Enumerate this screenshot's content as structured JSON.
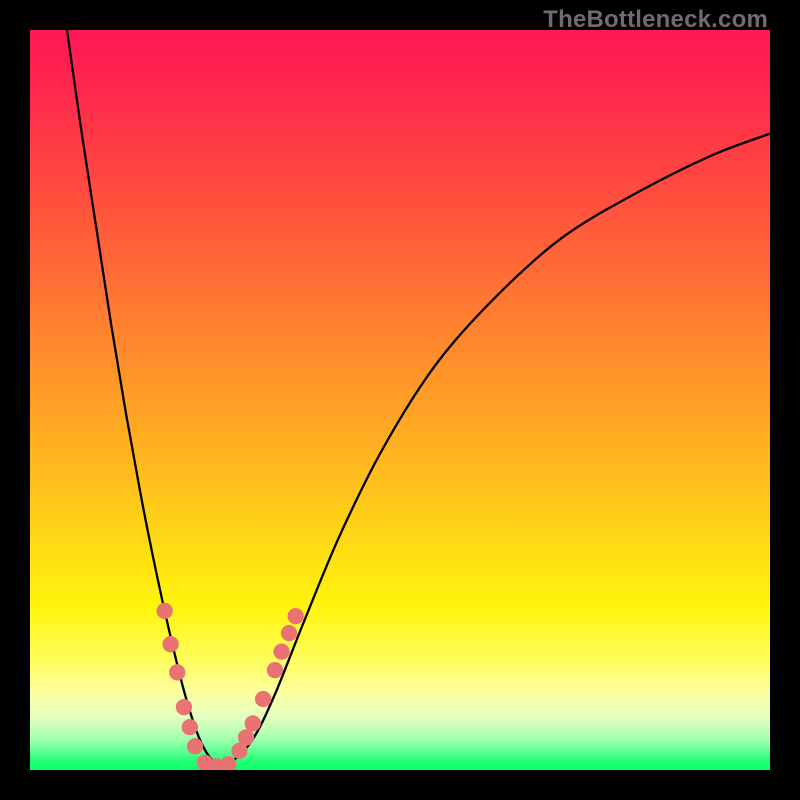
{
  "watermark": "TheBottleneck.com",
  "palette": {
    "frame": "#000000",
    "watermark": "#6d6d6d",
    "curve": "#000000",
    "marker": "#e97373",
    "gradient_top": "#ff1854",
    "gradient_bottom": "#0dff68"
  },
  "chart_data": {
    "type": "line",
    "title": "",
    "xlabel": "",
    "ylabel": "",
    "xlim": [
      0,
      100
    ],
    "ylim": [
      0,
      100
    ],
    "grid": false,
    "legend": false,
    "series": [
      {
        "name": "bottleneck-curve",
        "x": [
          5,
          7,
          9,
          11,
          13,
          15,
          17,
          19,
          21,
          23,
          25,
          27,
          30,
          33,
          37,
          42,
          48,
          55,
          63,
          72,
          82,
          92,
          100
        ],
        "y": [
          100,
          86,
          73,
          60,
          48,
          37,
          27,
          18,
          10,
          4,
          1,
          1,
          4,
          10,
          20,
          32,
          44,
          55,
          64,
          72,
          78,
          83,
          86
        ]
      }
    ],
    "markers": {
      "name": "highlighted-points",
      "points": [
        {
          "x": 18.2,
          "y": 21.5
        },
        {
          "x": 19.0,
          "y": 17.0
        },
        {
          "x": 19.9,
          "y": 13.2
        },
        {
          "x": 20.8,
          "y": 8.5
        },
        {
          "x": 21.6,
          "y": 5.8
        },
        {
          "x": 22.3,
          "y": 3.2
        },
        {
          "x": 23.6,
          "y": 1.0
        },
        {
          "x": 25.2,
          "y": 0.5
        },
        {
          "x": 26.8,
          "y": 0.8
        },
        {
          "x": 28.3,
          "y": 2.6
        },
        {
          "x": 29.2,
          "y": 4.4
        },
        {
          "x": 30.1,
          "y": 6.3
        },
        {
          "x": 31.5,
          "y": 9.6
        },
        {
          "x": 33.1,
          "y": 13.5
        },
        {
          "x": 34.0,
          "y": 16.0
        },
        {
          "x": 35.0,
          "y": 18.5
        },
        {
          "x": 35.9,
          "y": 20.8
        }
      ],
      "radius": 1.1
    }
  }
}
